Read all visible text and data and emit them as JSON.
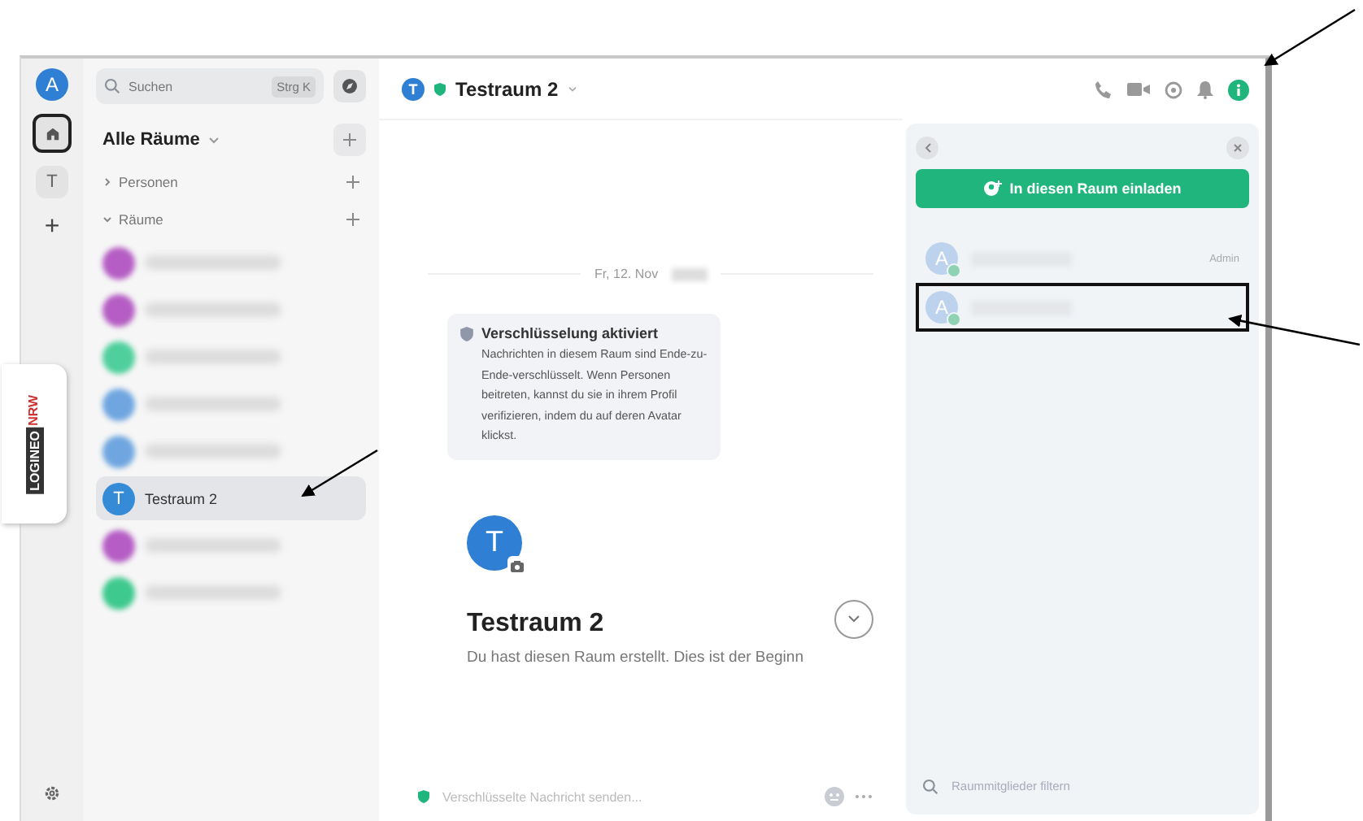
{
  "rail": {
    "avatar": "A",
    "spaces": [
      {
        "kind": "home",
        "selected": true
      },
      {
        "kind": "letter",
        "label": "T",
        "selected": false
      },
      {
        "kind": "add",
        "label": "+",
        "selected": false
      }
    ]
  },
  "logo_tab": {
    "word_1": "LOGINEO",
    "word_2": "NRW"
  },
  "search": {
    "placeholder": "Suchen",
    "shortcut": "Strg K"
  },
  "room_list": {
    "title": "Alle Räume",
    "sections": [
      {
        "label": "Personen",
        "expanded": false
      },
      {
        "label": "Räume",
        "expanded": true
      }
    ],
    "rooms": [
      {
        "kind": "blurred",
        "color": "#b55dc4",
        "selected": false
      },
      {
        "kind": "blurred",
        "color": "#b55dc4",
        "selected": false
      },
      {
        "kind": "blurred",
        "color": "#4fcf9c",
        "selected": false
      },
      {
        "kind": "blurred",
        "color": "#6fa6e0",
        "selected": false
      },
      {
        "kind": "blurred",
        "color": "#6fa6e0",
        "selected": false
      },
      {
        "kind": "named",
        "avatar": "T",
        "name": "Testraum 2",
        "color": "#368bd6",
        "selected": true
      },
      {
        "kind": "blurred",
        "color": "#b55dc4",
        "selected": false
      },
      {
        "kind": "blurred",
        "color": "#3ec98e",
        "selected": false
      }
    ]
  },
  "header": {
    "avatar": "T",
    "title": "Testraum 2"
  },
  "timeline": {
    "date": "Fr, 12. Nov",
    "notice_title": "Verschlüsselung aktiviert",
    "notice_body": "Nachrichten in diesem Raum sind Ende-zu-Ende-verschlüsselt. Wenn Personen beitreten, kannst du sie in ihrem Profil verifizieren, indem du auf deren Avatar klickst.",
    "intro_avatar": "T",
    "intro_title": "Testraum 2",
    "intro_text": "Du hast diesen Raum erstellt. Dies ist der Beginn"
  },
  "composer": {
    "placeholder": "Verschlüsselte Nachricht senden..."
  },
  "members_panel": {
    "invite_button": "In diesen Raum einladen",
    "members": [
      {
        "avatar": "A",
        "role": "Admin",
        "marked": false
      },
      {
        "avatar": "A",
        "marked": true
      }
    ],
    "filter_placeholder": "Raummitglieder filtern"
  }
}
